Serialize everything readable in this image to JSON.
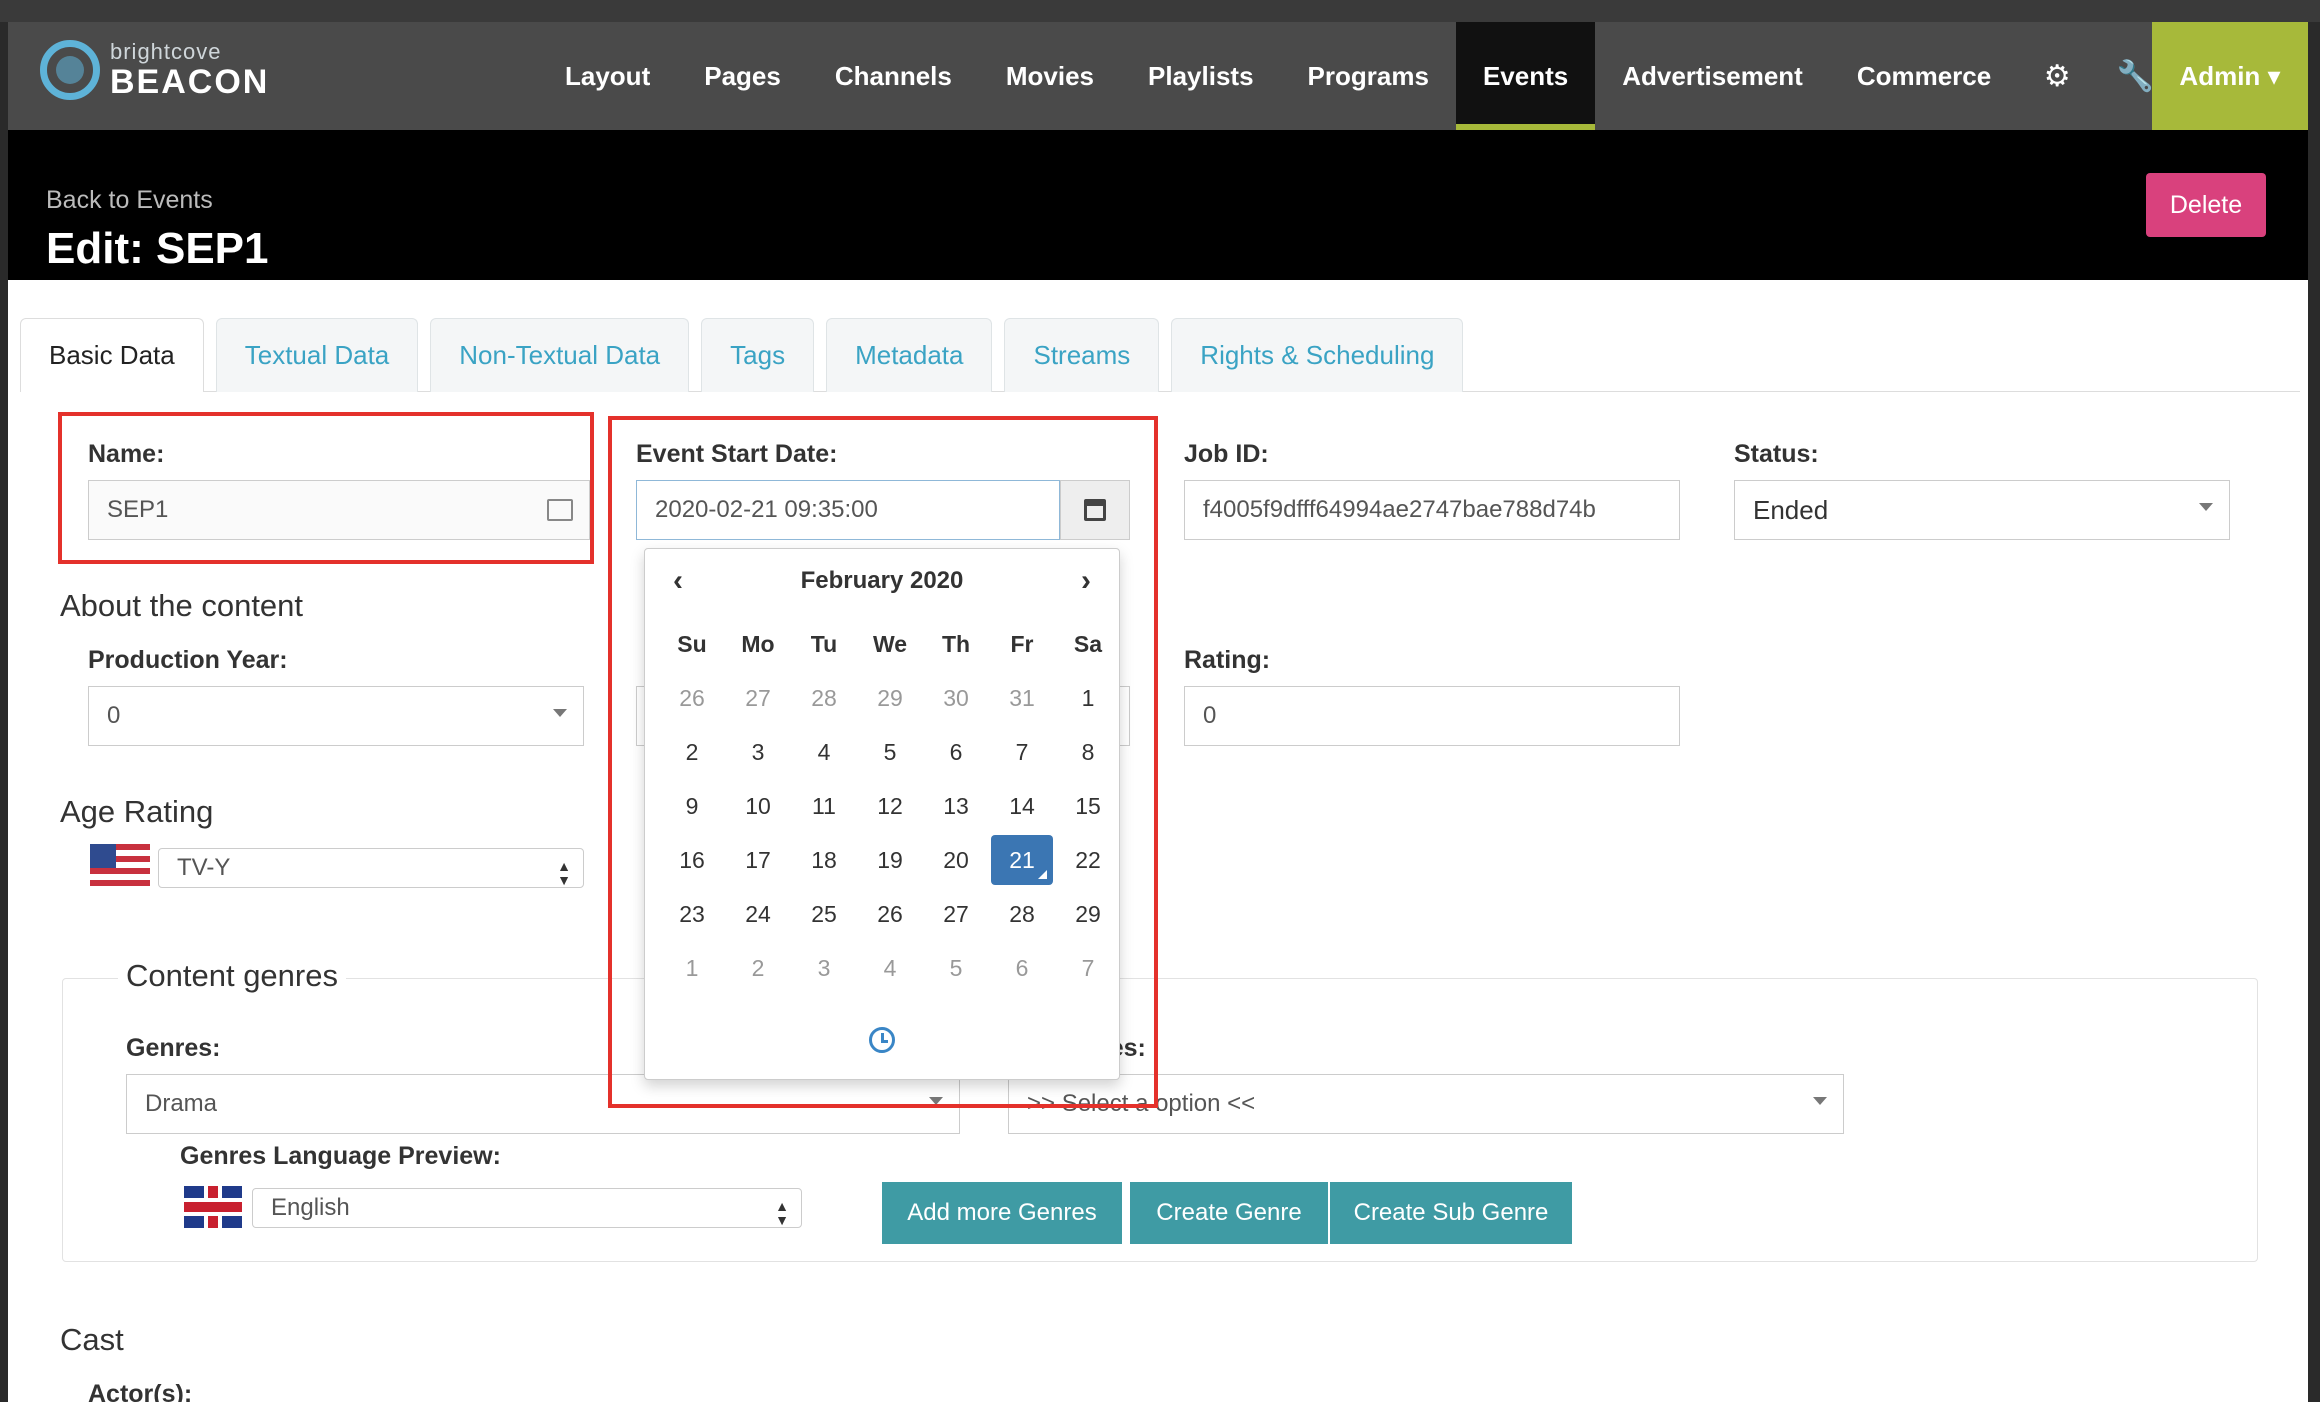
{
  "nav": {
    "logo_small": "brightcove",
    "logo_big": "BEACON",
    "items": [
      "Layout",
      "Pages",
      "Channels",
      "Movies",
      "Playlists",
      "Programs",
      "Events",
      "Advertisement",
      "Commerce"
    ],
    "active": "Events",
    "admin_label": "Admin ▾"
  },
  "header": {
    "back_link": "Back to Events",
    "title": "Edit: SEP1",
    "delete_label": "Delete"
  },
  "tabs": [
    "Basic Data",
    "Textual Data",
    "Non-Textual Data",
    "Tags",
    "Metadata",
    "Streams",
    "Rights & Scheduling"
  ],
  "form": {
    "name_label": "Name:",
    "name_value": "SEP1",
    "event_start_label": "Event Start Date:",
    "event_start_value": "2020-02-21 09:35:00",
    "job_id_label": "Job ID:",
    "job_id_value": "f4005f9dfff64994ae2747bae788d74b",
    "status_label": "Status:",
    "status_value": "Ended",
    "about_title": "About the content",
    "production_year_label": "Production Year:",
    "production_year_value": "0",
    "rating_label": "Rating:",
    "rating_value": "0",
    "age_rating_title": "Age Rating",
    "age_rating_value": "TV-Y",
    "content_genres_title": "Content genres",
    "genres_label": "Genres:",
    "genres_value": "Drama",
    "subgenres_label_partial": "res:",
    "subgenres_placeholder": ">> Select a option <<",
    "genres_lang_label": "Genres Language Preview:",
    "genres_lang_value": "English",
    "add_more_genres": "Add more Genres",
    "create_genre": "Create Genre",
    "create_sub_genre": "Create Sub Genre",
    "cast_title": "Cast",
    "actors_label": "Actor(s):"
  },
  "calendar": {
    "month": "February 2020",
    "prev": "‹",
    "next": "›",
    "weekdays": [
      "Su",
      "Mo",
      "Tu",
      "We",
      "Th",
      "Fr",
      "Sa"
    ],
    "weeks": [
      [
        "26",
        "27",
        "28",
        "29",
        "30",
        "31",
        "1"
      ],
      [
        "2",
        "3",
        "4",
        "5",
        "6",
        "7",
        "8"
      ],
      [
        "9",
        "10",
        "11",
        "12",
        "13",
        "14",
        "15"
      ],
      [
        "16",
        "17",
        "18",
        "19",
        "20",
        "21",
        "22"
      ],
      [
        "23",
        "24",
        "25",
        "26",
        "27",
        "28",
        "29"
      ],
      [
        "1",
        "2",
        "3",
        "4",
        "5",
        "6",
        "7"
      ]
    ],
    "selected": "21"
  }
}
